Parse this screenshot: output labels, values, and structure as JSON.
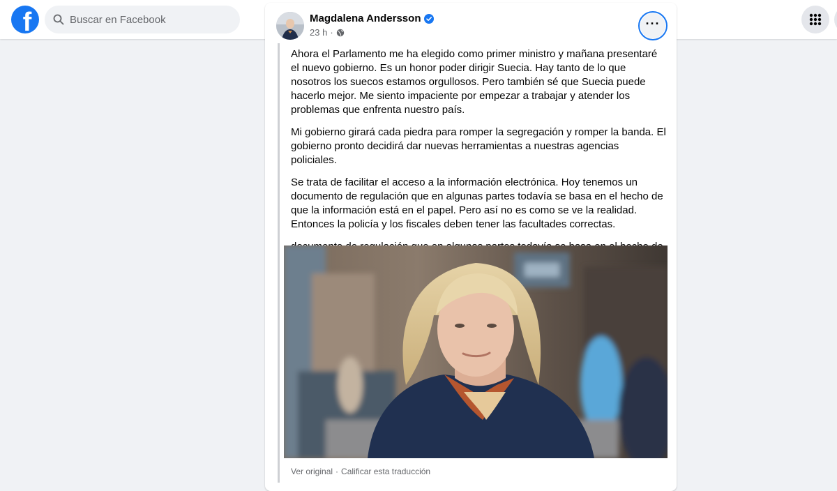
{
  "topbar": {
    "logo_letter": "f",
    "search_placeholder": "Buscar en Facebook",
    "menu_icon": "grid-menu-icon"
  },
  "post": {
    "author": "Magdalena Andersson",
    "verified": true,
    "time": "23 h",
    "privacy_icon": "globe-icon",
    "paragraphs": [
      "Ahora el Parlamento me ha elegido como primer ministro y mañana presentaré el nuevo gobierno. Es un honor poder dirigir Suecia. Hay tanto de lo que nosotros los suecos estamos orgullosos. Pero también sé que Suecia puede hacerlo mejor. Me siento impaciente por empezar a trabajar y atender los problemas que enfrenta nuestro país.",
      "Mi gobierno girará cada piedra para romper la segregación y romper la banda. El gobierno pronto decidirá dar nuevas herramientas a nuestras agencias policiales.",
      "Se trata de facilitar el acceso a la información electrónica. Hoy tenemos un documento de regulación que en algunas partes todavía se basa en el hecho de que la información está en el papel. Pero así no es como se ve la realidad. Entonces la policía y los fiscales deben tener las facultades correctas.",
      "documento de regulación que en algunas partes todavía se basa en el hecho de que la información está en el papel. Pero así no es como se ve la realidad."
    ],
    "footer": {
      "see_original": "Ver original",
      "rate_translation": "Calificar esta traducción"
    }
  },
  "colors": {
    "brand": "#1877f2",
    "background": "#f0f2f5",
    "secondary_text": "#65676b"
  }
}
